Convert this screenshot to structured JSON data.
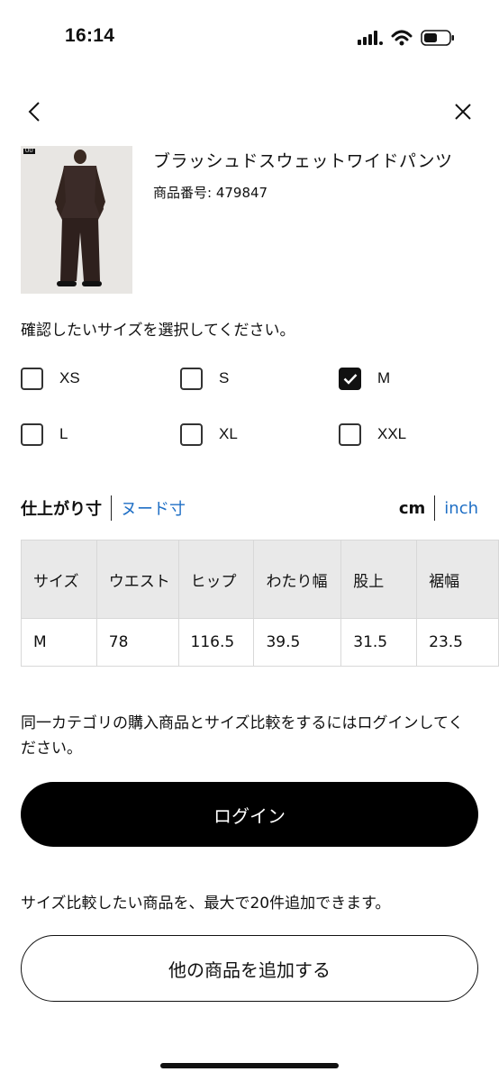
{
  "status_bar": {
    "time": "16:14",
    "icons": [
      "cellular-signal-icon",
      "wifi-icon",
      "battery-icon"
    ]
  },
  "nav": {
    "back_icon": "chevron-left-icon",
    "close_icon": "close-icon"
  },
  "product": {
    "name": "ブラッシュドスウェットワイドパンツ",
    "code": "商品番号: 479847",
    "badge": "UU"
  },
  "size_select": {
    "prompt": "確認したいサイズを選択してください。",
    "sizes": [
      {
        "label": "XS",
        "checked": false
      },
      {
        "label": "S",
        "checked": false
      },
      {
        "label": "M",
        "checked": true
      },
      {
        "label": "L",
        "checked": false
      },
      {
        "label": "XL",
        "checked": false
      },
      {
        "label": "XXL",
        "checked": false
      }
    ]
  },
  "measurement": {
    "finished_label": "仕上がり寸",
    "nude_label": "ヌード寸",
    "unit_cm": "cm",
    "unit_inch": "inch"
  },
  "table": {
    "headers": [
      "サイズ",
      "ウエスト",
      "ヒップ",
      "わたり幅",
      "股上",
      "裾幅"
    ],
    "rows": [
      [
        "M",
        "78",
        "116.5",
        "39.5",
        "31.5",
        "23.5"
      ]
    ]
  },
  "compare": {
    "text": "同一カテゴリの購入商品とサイズ比較をするにはログインしてください。",
    "login_label": "ログイン"
  },
  "add": {
    "text": "サイズ比較したい商品を、最大で20件追加できます。",
    "button_label": "他の商品を追加する"
  },
  "colors": {
    "link": "#1f6fc5",
    "primary_button": "#000000",
    "table_header_bg": "#e9e9e9"
  }
}
